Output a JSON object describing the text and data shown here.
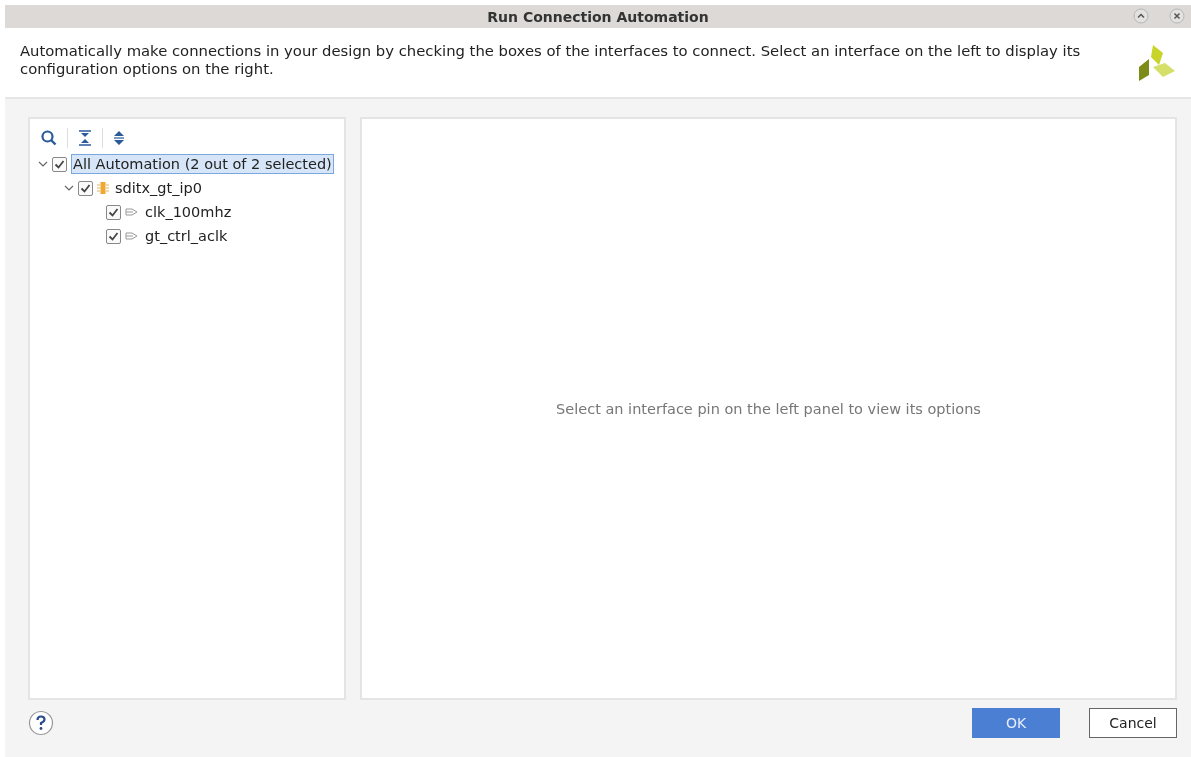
{
  "window": {
    "title": "Run Connection Automation"
  },
  "description": "Automatically make connections in your design by checking the boxes of the interfaces to connect. Select an interface on the left to display its configuration options on the right.",
  "tree": [
    {
      "label": "All Automation (2 out of 2 selected)",
      "checked": true,
      "expanded": true,
      "selected": true,
      "children": [
        {
          "label": "sditx_gt_ip0",
          "kind": "ip",
          "checked": true,
          "expanded": true,
          "selected": false,
          "children": [
            {
              "label": "clk_100mhz",
              "kind": "pin",
              "checked": true,
              "selected": false
            },
            {
              "label": "gt_ctrl_aclk",
              "kind": "pin",
              "checked": true,
              "selected": false
            }
          ]
        }
      ]
    }
  ],
  "options_panel": {
    "message": "Select an interface pin on the left panel to view its options"
  },
  "buttons": [
    {
      "label": "OK",
      "primary": true
    },
    {
      "label": "Cancel",
      "primary": false
    }
  ]
}
